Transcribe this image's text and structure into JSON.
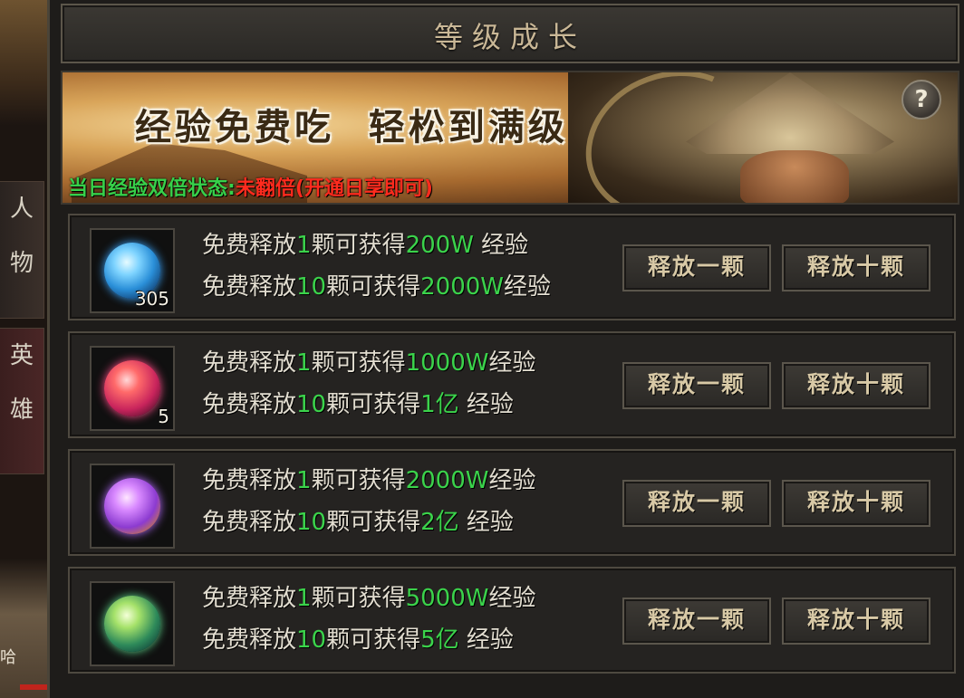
{
  "side": {
    "tab_person": [
      "人",
      "物"
    ],
    "tab_hero": [
      "英",
      "雄"
    ],
    "bottom_text": "哈"
  },
  "panel": {
    "title": "等级成长",
    "help_label": "?"
  },
  "banner": {
    "slogan": "经验免费吃 轻松到满级",
    "status_label": "当日经验双倍状态:",
    "status_value": "未翻倍(开通日享即可)"
  },
  "rows": [
    {
      "gem": "blue-orb",
      "count": "305",
      "line1": {
        "pre": "免费释放",
        "n": "1",
        "mid": "颗可获得",
        "amt": "200W",
        "post": " 经验"
      },
      "line2": {
        "pre": "免费释放",
        "n": "10",
        "mid": "颗可获得",
        "amt": "2000W",
        "post": "经验"
      },
      "btn_one": "释放一颗",
      "btn_ten": "释放十颗"
    },
    {
      "gem": "red-orb",
      "count": "5",
      "line1": {
        "pre": "免费释放",
        "n": "1",
        "mid": "颗可获得",
        "amt": "1000W",
        "post": "经验"
      },
      "line2": {
        "pre": "免费释放",
        "n": "10",
        "mid": "颗可获得",
        "amt": "1亿",
        "post": " 经验"
      },
      "btn_one": "释放一颗",
      "btn_ten": "释放十颗"
    },
    {
      "gem": "purple-orb",
      "count": "",
      "line1": {
        "pre": "免费释放",
        "n": "1",
        "mid": "颗可获得",
        "amt": "2000W",
        "post": "经验"
      },
      "line2": {
        "pre": "免费释放",
        "n": "10",
        "mid": "颗可获得",
        "amt": "2亿",
        "post": " 经验"
      },
      "btn_one": "释放一颗",
      "btn_ten": "释放十颗"
    },
    {
      "gem": "green-orb",
      "count": "",
      "line1": {
        "pre": "免费释放",
        "n": "1",
        "mid": "颗可获得",
        "amt": "5000W",
        "post": "经验"
      },
      "line2": {
        "pre": "免费释放",
        "n": "10",
        "mid": "颗可获得",
        "amt": "5亿",
        "post": " 经验"
      },
      "btn_one": "释放一颗",
      "btn_ten": "释放十颗"
    }
  ]
}
